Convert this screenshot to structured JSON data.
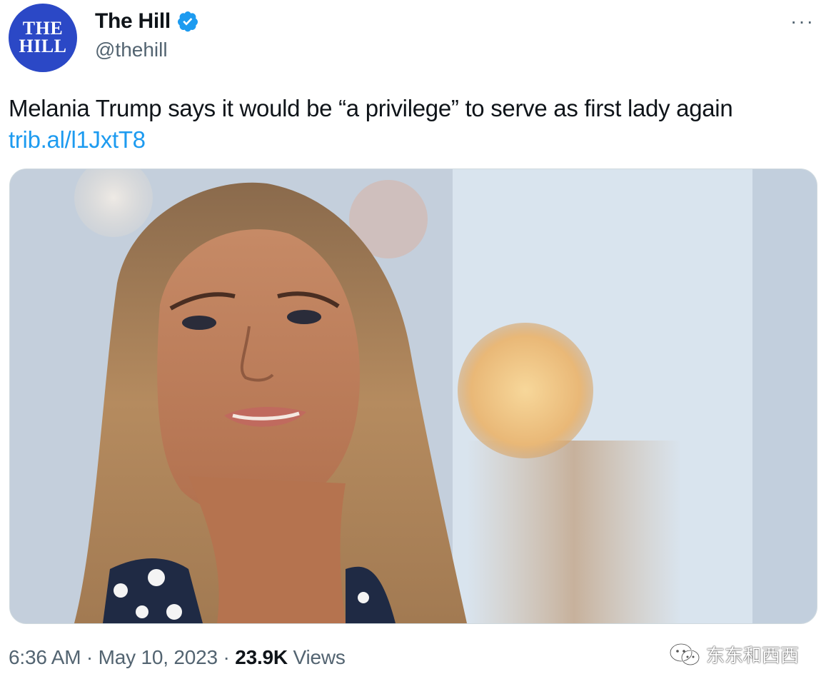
{
  "author": {
    "avatar_lines": [
      "THE",
      "HILL"
    ],
    "display_name": "The Hill",
    "handle": "@thehill",
    "verified": true
  },
  "menu": {
    "more_icon": "more-horizontal-icon",
    "more_glyph": "···"
  },
  "tweet": {
    "text": "Melania Trump says it would be “a privilege” to serve as first lady again",
    "link": "trib.al/l1JxtT8"
  },
  "media": {
    "alt": "photo"
  },
  "meta": {
    "time": "6:36 AM",
    "sep1": " · ",
    "date": "May 10, 2023",
    "sep2": " · ",
    "views_count": "23.9K",
    "views_label": " Views"
  },
  "watermark": {
    "text": "东东和西西",
    "icon": "wechat-icon"
  },
  "colors": {
    "avatar_bg": "#2b48c6",
    "link": "#1d9bf0",
    "secondary_text": "#536471",
    "verified": "#1d9bf0"
  }
}
